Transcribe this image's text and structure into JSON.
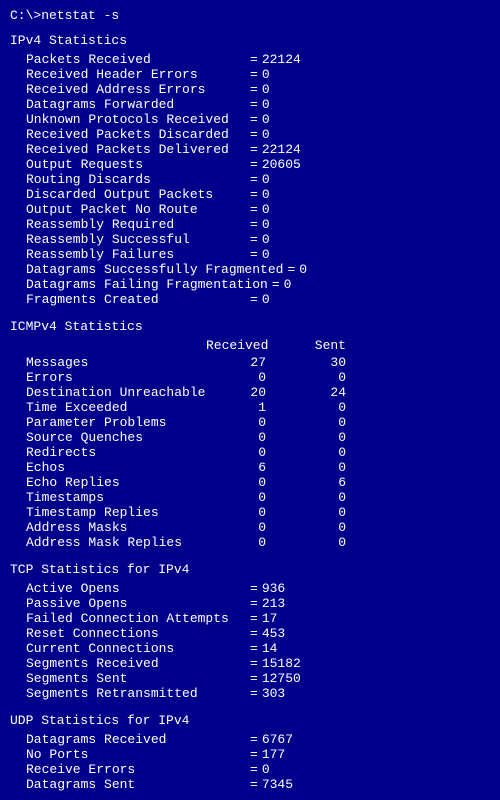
{
  "command": "C:\\>netstat -s",
  "sections": {
    "ipv4": {
      "header": "IPv4 Statistics",
      "rows": [
        {
          "label": "Packets Received",
          "eq": "=",
          "value": "22124"
        },
        {
          "label": "Received Header Errors",
          "eq": "=",
          "value": "0"
        },
        {
          "label": "Received Address Errors",
          "eq": "=",
          "value": "0"
        },
        {
          "label": "Datagrams Forwarded",
          "eq": "=",
          "value": "0"
        },
        {
          "label": "Unknown Protocols Received",
          "eq": "=",
          "value": "0"
        },
        {
          "label": "Received Packets Discarded",
          "eq": "=",
          "value": "0"
        },
        {
          "label": "Received Packets Delivered",
          "eq": "=",
          "value": "22124"
        },
        {
          "label": "Output Requests",
          "eq": "=",
          "value": "20605"
        },
        {
          "label": "Routing Discards",
          "eq": "=",
          "value": "0"
        },
        {
          "label": "Discarded Output Packets",
          "eq": "=",
          "value": "0"
        },
        {
          "label": "Output Packet No Route",
          "eq": "=",
          "value": "0"
        },
        {
          "label": "Reassembly Required",
          "eq": "=",
          "value": "0"
        },
        {
          "label": "Reassembly Successful",
          "eq": "=",
          "value": "0"
        },
        {
          "label": "Reassembly Failures",
          "eq": "=",
          "value": "0"
        },
        {
          "label": "Datagrams Successfully Fragmented",
          "eq": "=",
          "value": "0"
        },
        {
          "label": "Datagrams Failing Fragmentation",
          "eq": "=",
          "value": "0"
        },
        {
          "label": "Fragments Created",
          "eq": "=",
          "value": "0"
        }
      ]
    },
    "icmpv4": {
      "header": "ICMPv4 Statistics",
      "col_received": "Received",
      "col_sent": "Sent",
      "rows": [
        {
          "label": "Messages",
          "received": "27",
          "sent": "30"
        },
        {
          "label": "Errors",
          "received": "0",
          "sent": "0"
        },
        {
          "label": "Destination Unreachable",
          "received": "20",
          "sent": "24"
        },
        {
          "label": "Time Exceeded",
          "received": "1",
          "sent": "0"
        },
        {
          "label": "Parameter Problems",
          "received": "0",
          "sent": "0"
        },
        {
          "label": "Source Quenches",
          "received": "0",
          "sent": "0"
        },
        {
          "label": "Redirects",
          "received": "0",
          "sent": "0"
        },
        {
          "label": "Echos",
          "received": "6",
          "sent": "0"
        },
        {
          "label": "Echo Replies",
          "received": "0",
          "sent": "6"
        },
        {
          "label": "Timestamps",
          "received": "0",
          "sent": "0"
        },
        {
          "label": "Timestamp Replies",
          "received": "0",
          "sent": "0"
        },
        {
          "label": "Address Masks",
          "received": "0",
          "sent": "0"
        },
        {
          "label": "Address Mask Replies",
          "received": "0",
          "sent": "0"
        }
      ]
    },
    "tcp": {
      "header": "TCP Statistics for IPv4",
      "rows": [
        {
          "label": "Active Opens",
          "eq": "=",
          "value": "936"
        },
        {
          "label": "Passive Opens",
          "eq": "=",
          "value": "213"
        },
        {
          "label": "Failed Connection Attempts",
          "eq": "=",
          "value": "17"
        },
        {
          "label": "Reset Connections",
          "eq": "=",
          "value": "453"
        },
        {
          "label": "Current Connections",
          "eq": "=",
          "value": "14"
        },
        {
          "label": "Segments Received",
          "eq": "=",
          "value": "15182"
        },
        {
          "label": "Segments Sent",
          "eq": "=",
          "value": "12750"
        },
        {
          "label": "Segments Retransmitted",
          "eq": "=",
          "value": "303"
        }
      ]
    },
    "udp": {
      "header": "UDP Statistics for IPv4",
      "rows": [
        {
          "label": "Datagrams Received",
          "eq": "=",
          "value": "6767"
        },
        {
          "label": "No Ports",
          "eq": "=",
          "value": "177"
        },
        {
          "label": "Receive Errors",
          "eq": "=",
          "value": "0"
        },
        {
          "label": "Datagrams Sent",
          "eq": "=",
          "value": "7345"
        }
      ]
    }
  }
}
